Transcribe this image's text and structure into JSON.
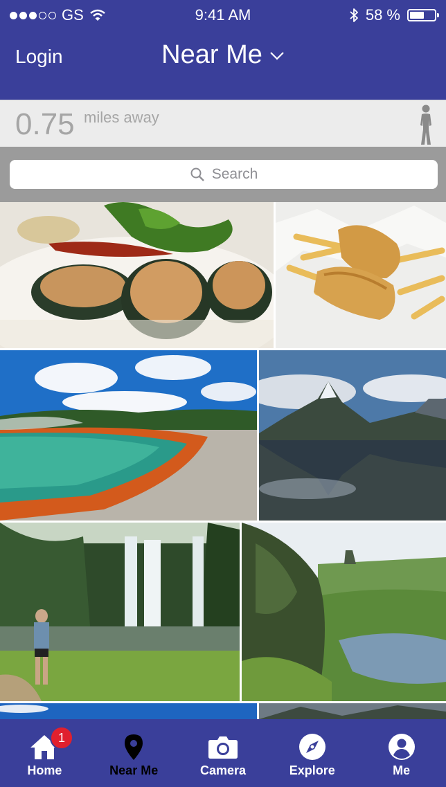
{
  "status_bar": {
    "carrier": "GS",
    "time": "9:41 AM",
    "battery_percent": "58 %",
    "battery_level": 0.58
  },
  "nav": {
    "login_label": "Login",
    "title": "Near Me"
  },
  "distance": {
    "value": "0.75",
    "unit": "miles away"
  },
  "search": {
    "placeholder": "Search"
  },
  "photos": [
    {
      "name": "photo-mussels"
    },
    {
      "name": "photo-fish-and-chips"
    },
    {
      "name": "photo-hot-spring"
    },
    {
      "name": "photo-fiord"
    },
    {
      "name": "photo-waterfall"
    },
    {
      "name": "photo-river-valley"
    }
  ],
  "tabs": [
    {
      "label": "Home",
      "icon": "home-icon",
      "badge": "1"
    },
    {
      "label": "Near Me",
      "icon": "location-pin-icon"
    },
    {
      "label": "Camera",
      "icon": "camera-icon"
    },
    {
      "label": "Explore",
      "icon": "compass-icon"
    },
    {
      "label": "Me",
      "icon": "user-icon"
    }
  ],
  "colors": {
    "brand": "#3a3f9a",
    "badge": "#e0202e",
    "active_tab": "#000000"
  }
}
